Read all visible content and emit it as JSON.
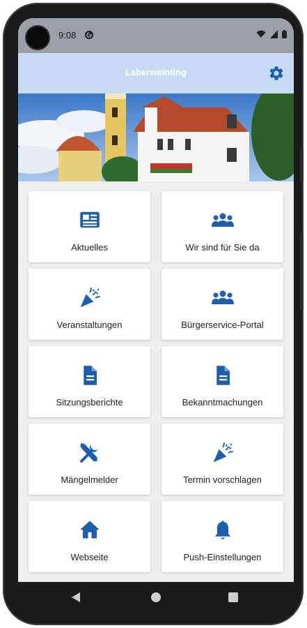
{
  "status_bar": {
    "time": "9:08"
  },
  "app_bar": {
    "title": "Laberweinting",
    "settings_icon": "gear-icon"
  },
  "colors": {
    "accent": "#1e5fad",
    "app_bar_bg": "#c7dcf2",
    "tile_bg": "#ffffff",
    "screen_bg": "#eeeeee"
  },
  "tiles": [
    {
      "label": "Aktuelles",
      "icon": "newspaper-icon"
    },
    {
      "label": "Wir sind für Sie da",
      "icon": "people-group-icon"
    },
    {
      "label": "Veranstaltungen",
      "icon": "party-popper-icon"
    },
    {
      "label": "Bürgerservice-Portal",
      "icon": "people-group-icon"
    },
    {
      "label": "Sitzungsberichte",
      "icon": "document-icon"
    },
    {
      "label": "Bekanntmachungen",
      "icon": "document-icon"
    },
    {
      "label": "Mängelmelder",
      "icon": "tools-icon"
    },
    {
      "label": "Termin vorschlagen",
      "icon": "party-popper-icon"
    },
    {
      "label": "Webseite",
      "icon": "home-icon"
    },
    {
      "label": "Push-Einstellungen",
      "icon": "bell-icon"
    }
  ],
  "nav_bar": {
    "back_icon": "back-triangle-icon",
    "home_icon": "home-circle-icon",
    "recents_icon": "recents-square-icon"
  }
}
